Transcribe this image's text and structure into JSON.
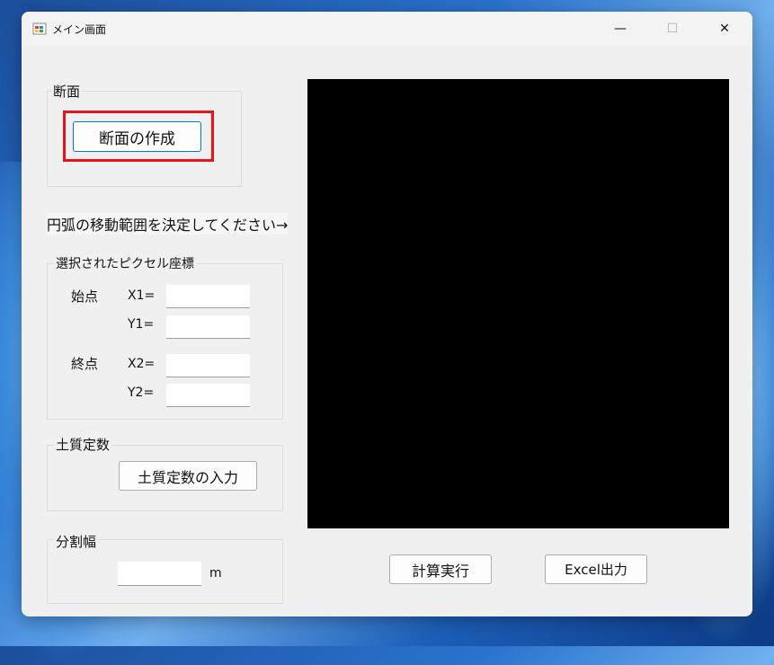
{
  "window": {
    "title": "メイン画面",
    "minimize_glyph": "—",
    "maximize_glyph": "☐",
    "close_glyph": "✕"
  },
  "section": {
    "label": "断面",
    "create_button": "断面の作成"
  },
  "instruction_text": "円弧の移動範囲を決定してください→",
  "pixel_coords": {
    "label": "選択されたピクセル座標",
    "start_label": "始点",
    "end_label": "終点",
    "x1_label": "X1=",
    "y1_label": "Y1=",
    "x2_label": "X2=",
    "y2_label": "Y2=",
    "x1_value": "",
    "y1_value": "",
    "x2_value": "",
    "y2_value": ""
  },
  "soil": {
    "label": "土質定数",
    "input_button": "土質定数の入力"
  },
  "division": {
    "label": "分割幅",
    "value": "",
    "unit": "m"
  },
  "actions": {
    "calc_button": "計算実行",
    "excel_button": "Excel出力"
  },
  "colors": {
    "highlight": "#e8141c",
    "canvas": "#000000",
    "focus": "#0078d4"
  }
}
